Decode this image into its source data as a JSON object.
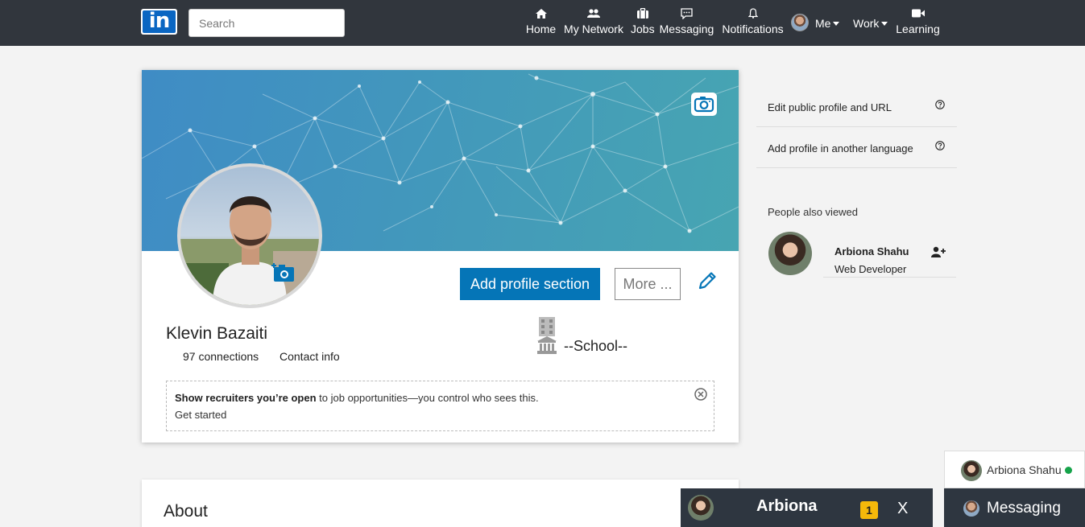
{
  "nav": {
    "logo_text": "in",
    "search_placeholder": "Search",
    "items": [
      {
        "label": "Home",
        "icon": "home-icon"
      },
      {
        "label": "My Network",
        "icon": "network-icon"
      },
      {
        "label": "Jobs",
        "icon": "briefcase-icon"
      },
      {
        "label": "Messaging",
        "icon": "chat-icon"
      },
      {
        "label": "Notifications",
        "icon": "bell-icon"
      },
      {
        "label": "Learning",
        "icon": "video-icon"
      }
    ],
    "me_label": "Me",
    "work_label": "Work"
  },
  "profile": {
    "name": "Klevin Bazaiti",
    "connections": "97 connections",
    "contact_info": "Contact info",
    "school": "--School--",
    "add_section_label": "Add profile section",
    "more_label": "More ..."
  },
  "recruiter": {
    "bold_text": "Show recruiters you’re open",
    "rest_text": " to job opportunities—you control who sees this.",
    "get_started": "Get started"
  },
  "about": {
    "title": "About"
  },
  "rail": {
    "edit_public_profile": "Edit public profile and URL",
    "add_language": "Add profile in another language",
    "people_also_viewed": "People also viewed",
    "person": {
      "name": "Arbiona Shahu",
      "title": "Web Developer"
    }
  },
  "messaging": {
    "chat_name": "Arbiona",
    "unread_count": "1",
    "close_label": "X",
    "contact_name": "Arbiona Shahu",
    "bar_label": "Messaging",
    "online_color": "#16a34a"
  },
  "colors": {
    "nav_bg": "#31363d",
    "primary": "#0575b7",
    "badge": "#f5b90a"
  }
}
